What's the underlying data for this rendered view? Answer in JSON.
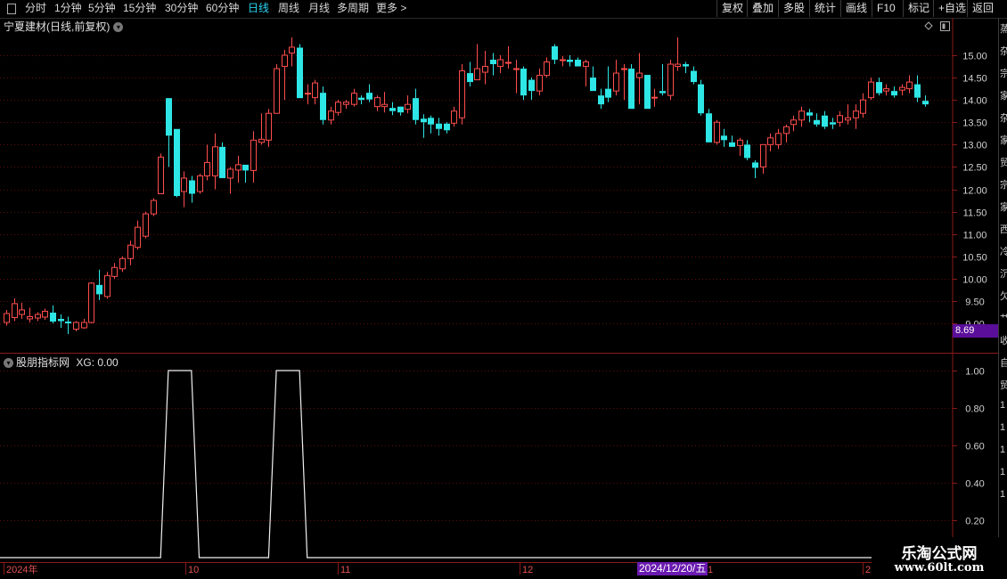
{
  "toolbar": {
    "timeframes": [
      "分时",
      "1分钟",
      "5分钟",
      "15分钟",
      "30分钟",
      "60分钟",
      "日线",
      "周线",
      "月线",
      "多周期",
      "更多 >"
    ],
    "active_timeframe": "日线",
    "buttons": [
      "复权",
      "叠加",
      "多股",
      "统计",
      "画线",
      "F10",
      "标记",
      "+自选",
      "返回"
    ]
  },
  "main_chart": {
    "title": "宁夏建材(日线,前复权)",
    "price_axis_labels": [
      "15.00",
      "14.50",
      "14.00",
      "13.50",
      "13.00",
      "12.50",
      "12.00",
      "11.50",
      "11.00",
      "10.50",
      "10.00",
      "9.50",
      "9.00"
    ],
    "current_price": "8.69",
    "colors": {
      "up": "#ff4d4d",
      "down": "#2ee6e6",
      "grid": "#5c0c0c",
      "axis_text": "#d0d0d0"
    }
  },
  "indicator": {
    "title": "股朋指标网",
    "value_text": "XG: 0.00",
    "axis_labels": [
      "1.00",
      "0.80",
      "0.60",
      "0.40",
      "0.20"
    ]
  },
  "time_axis": {
    "labels": [
      "2024年",
      "10",
      "11",
      "12",
      "1",
      "2"
    ],
    "selected_date": "2024/12/20/五"
  },
  "watermark": {
    "line1": "乐淘公式网",
    "line2": "www.60lt.com"
  },
  "side_panel": {
    "chars": [
      "蒸",
      "杂",
      "宗",
      "家",
      "杂",
      "家",
      "贸",
      "宗",
      "家",
      "西",
      "冷",
      "沉",
      "欠",
      "艹",
      "收",
      "自",
      "贸",
      "1",
      "1",
      "1",
      "1",
      "1"
    ]
  },
  "chart_data": {
    "type": "candlestick",
    "title": "宁夏建材(日线,前复权)",
    "ylim": [
      8.7,
      15.5
    ],
    "x_tick_labels": [
      "2024年",
      "10",
      "11",
      "12",
      "1",
      "2"
    ],
    "candles": [
      {
        "o": 9.02,
        "h": 9.3,
        "l": 8.95,
        "c": 9.22
      },
      {
        "o": 9.13,
        "h": 9.56,
        "l": 9.05,
        "c": 9.44
      },
      {
        "o": 9.2,
        "h": 9.46,
        "l": 9.1,
        "c": 9.3
      },
      {
        "o": 9.1,
        "h": 9.35,
        "l": 9.02,
        "c": 9.15
      },
      {
        "o": 9.12,
        "h": 9.25,
        "l": 9.05,
        "c": 9.2
      },
      {
        "o": 9.14,
        "h": 9.33,
        "l": 9.08,
        "c": 9.27
      },
      {
        "o": 9.24,
        "h": 9.4,
        "l": 9.0,
        "c": 9.04
      },
      {
        "o": 9.1,
        "h": 9.2,
        "l": 8.9,
        "c": 9.05
      },
      {
        "o": 9.04,
        "h": 9.15,
        "l": 8.76,
        "c": 9.0
      },
      {
        "o": 8.87,
        "h": 9.05,
        "l": 8.82,
        "c": 9.02
      },
      {
        "o": 8.9,
        "h": 9.1,
        "l": 8.88,
        "c": 9.02
      },
      {
        "o": 9.02,
        "h": 9.92,
        "l": 9.0,
        "c": 9.9
      },
      {
        "o": 9.86,
        "h": 10.2,
        "l": 9.52,
        "c": 9.65
      },
      {
        "o": 9.6,
        "h": 10.15,
        "l": 9.55,
        "c": 10.07
      },
      {
        "o": 10.05,
        "h": 10.35,
        "l": 10.0,
        "c": 10.25
      },
      {
        "o": 10.22,
        "h": 10.5,
        "l": 10.15,
        "c": 10.45
      },
      {
        "o": 10.45,
        "h": 10.85,
        "l": 10.3,
        "c": 10.75
      },
      {
        "o": 10.7,
        "h": 11.3,
        "l": 10.65,
        "c": 11.15
      },
      {
        "o": 10.95,
        "h": 11.5,
        "l": 10.9,
        "c": 11.45
      },
      {
        "o": 11.45,
        "h": 11.8,
        "l": 11.4,
        "c": 11.75
      },
      {
        "o": 11.9,
        "h": 12.8,
        "l": 11.9,
        "c": 12.72
      },
      {
        "o": 14.04,
        "h": 14.04,
        "l": 12.5,
        "c": 13.2
      },
      {
        "o": 13.35,
        "h": 13.35,
        "l": 11.82,
        "c": 11.85
      },
      {
        "o": 11.95,
        "h": 12.4,
        "l": 11.6,
        "c": 12.25
      },
      {
        "o": 12.2,
        "h": 12.3,
        "l": 11.7,
        "c": 11.9
      },
      {
        "o": 11.95,
        "h": 12.35,
        "l": 11.9,
        "c": 12.3
      },
      {
        "o": 12.3,
        "h": 13.0,
        "l": 12.2,
        "c": 12.6
      },
      {
        "o": 12.3,
        "h": 13.25,
        "l": 12.0,
        "c": 12.95
      },
      {
        "o": 12.95,
        "h": 13.05,
        "l": 12.25,
        "c": 12.25
      },
      {
        "o": 12.25,
        "h": 12.5,
        "l": 11.9,
        "c": 12.45
      },
      {
        "o": 12.43,
        "h": 12.75,
        "l": 12.15,
        "c": 12.55
      },
      {
        "o": 12.55,
        "h": 12.55,
        "l": 12.15,
        "c": 12.42
      },
      {
        "o": 12.42,
        "h": 13.3,
        "l": 12.15,
        "c": 13.1
      },
      {
        "o": 13.05,
        "h": 13.7,
        "l": 13.0,
        "c": 13.12
      },
      {
        "o": 13.1,
        "h": 13.8,
        "l": 12.95,
        "c": 13.7
      },
      {
        "o": 13.7,
        "h": 14.8,
        "l": 13.7,
        "c": 14.7
      },
      {
        "o": 14.75,
        "h": 15.12,
        "l": 14.0,
        "c": 15.0
      },
      {
        "o": 15.05,
        "h": 15.4,
        "l": 14.75,
        "c": 15.18
      },
      {
        "o": 15.17,
        "h": 15.25,
        "l": 14.04,
        "c": 14.04
      },
      {
        "o": 14.14,
        "h": 14.35,
        "l": 13.9,
        "c": 14.15
      },
      {
        "o": 14.05,
        "h": 14.45,
        "l": 13.9,
        "c": 14.38
      },
      {
        "o": 14.16,
        "h": 14.3,
        "l": 13.45,
        "c": 13.55
      },
      {
        "o": 13.55,
        "h": 13.85,
        "l": 13.45,
        "c": 13.75
      },
      {
        "o": 13.72,
        "h": 14.0,
        "l": 13.65,
        "c": 13.95
      },
      {
        "o": 13.9,
        "h": 14.0,
        "l": 13.8,
        "c": 13.95
      },
      {
        "o": 13.9,
        "h": 14.25,
        "l": 13.85,
        "c": 14.15
      },
      {
        "o": 14.05,
        "h": 14.1,
        "l": 13.9,
        "c": 14.0
      },
      {
        "o": 14.16,
        "h": 14.35,
        "l": 13.95,
        "c": 14.01
      },
      {
        "o": 13.85,
        "h": 14.1,
        "l": 13.75,
        "c": 14.05
      },
      {
        "o": 13.85,
        "h": 14.18,
        "l": 13.72,
        "c": 13.9
      },
      {
        "o": 13.82,
        "h": 13.95,
        "l": 13.66,
        "c": 13.75
      },
      {
        "o": 13.85,
        "h": 13.85,
        "l": 13.65,
        "c": 13.72
      },
      {
        "o": 13.79,
        "h": 14.1,
        "l": 13.7,
        "c": 13.9
      },
      {
        "o": 14.04,
        "h": 14.25,
        "l": 13.45,
        "c": 13.55
      },
      {
        "o": 13.58,
        "h": 13.68,
        "l": 13.15,
        "c": 13.5
      },
      {
        "o": 13.6,
        "h": 13.65,
        "l": 13.25,
        "c": 13.45
      },
      {
        "o": 13.47,
        "h": 13.6,
        "l": 13.2,
        "c": 13.35
      },
      {
        "o": 13.47,
        "h": 13.5,
        "l": 13.25,
        "c": 13.32
      },
      {
        "o": 13.48,
        "h": 13.85,
        "l": 13.4,
        "c": 13.75
      },
      {
        "o": 13.6,
        "h": 14.8,
        "l": 13.45,
        "c": 14.65
      },
      {
        "o": 14.6,
        "h": 14.85,
        "l": 14.3,
        "c": 14.4
      },
      {
        "o": 14.45,
        "h": 15.25,
        "l": 14.5,
        "c": 14.7
      },
      {
        "o": 14.62,
        "h": 15.1,
        "l": 14.35,
        "c": 14.75
      },
      {
        "o": 14.9,
        "h": 15.05,
        "l": 14.55,
        "c": 14.8
      },
      {
        "o": 14.75,
        "h": 15.0,
        "l": 14.6,
        "c": 14.9
      },
      {
        "o": 14.82,
        "h": 15.2,
        "l": 14.7,
        "c": 14.84
      },
      {
        "o": 14.7,
        "h": 14.9,
        "l": 14.15,
        "c": 14.7
      },
      {
        "o": 14.7,
        "h": 14.75,
        "l": 14.0,
        "c": 14.1
      },
      {
        "o": 14.45,
        "h": 14.5,
        "l": 14.0,
        "c": 14.2
      },
      {
        "o": 14.2,
        "h": 14.7,
        "l": 14.1,
        "c": 14.55
      },
      {
        "o": 14.55,
        "h": 14.95,
        "l": 14.5,
        "c": 14.85
      },
      {
        "o": 15.2,
        "h": 15.25,
        "l": 14.8,
        "c": 14.9
      },
      {
        "o": 14.88,
        "h": 14.98,
        "l": 14.75,
        "c": 14.9
      },
      {
        "o": 14.9,
        "h": 15.0,
        "l": 14.75,
        "c": 14.85
      },
      {
        "o": 14.9,
        "h": 14.95,
        "l": 14.75,
        "c": 14.75
      },
      {
        "o": 14.75,
        "h": 14.9,
        "l": 14.3,
        "c": 14.85
      },
      {
        "o": 14.5,
        "h": 14.75,
        "l": 14.2,
        "c": 14.2
      },
      {
        "o": 14.1,
        "h": 14.25,
        "l": 13.8,
        "c": 13.9
      },
      {
        "o": 14.25,
        "h": 14.75,
        "l": 13.95,
        "c": 14.05
      },
      {
        "o": 14.2,
        "h": 14.9,
        "l": 14.1,
        "c": 14.6
      },
      {
        "o": 14.7,
        "h": 14.8,
        "l": 14.0,
        "c": 14.7
      },
      {
        "o": 14.7,
        "h": 14.8,
        "l": 13.8,
        "c": 13.8
      },
      {
        "o": 14.5,
        "h": 15.05,
        "l": 13.9,
        "c": 14.6
      },
      {
        "o": 14.56,
        "h": 14.56,
        "l": 13.8,
        "c": 13.8
      },
      {
        "o": 14.06,
        "h": 14.25,
        "l": 13.85,
        "c": 14.06
      },
      {
        "o": 14.2,
        "h": 14.8,
        "l": 14.1,
        "c": 14.15
      },
      {
        "o": 14.1,
        "h": 14.9,
        "l": 14.0,
        "c": 14.8
      },
      {
        "o": 14.75,
        "h": 15.4,
        "l": 14.65,
        "c": 14.8
      },
      {
        "o": 14.8,
        "h": 14.85,
        "l": 14.6,
        "c": 14.75
      },
      {
        "o": 14.65,
        "h": 14.75,
        "l": 14.35,
        "c": 14.4
      },
      {
        "o": 14.35,
        "h": 14.45,
        "l": 13.65,
        "c": 13.7
      },
      {
        "o": 13.7,
        "h": 13.8,
        "l": 13.05,
        "c": 13.05
      },
      {
        "o": 13.05,
        "h": 13.55,
        "l": 13.0,
        "c": 13.5
      },
      {
        "o": 13.2,
        "h": 13.35,
        "l": 12.95,
        "c": 13.1
      },
      {
        "o": 13.05,
        "h": 13.2,
        "l": 12.95,
        "c": 12.95
      },
      {
        "o": 12.98,
        "h": 13.15,
        "l": 12.75,
        "c": 13.1
      },
      {
        "o": 13.0,
        "h": 13.1,
        "l": 12.65,
        "c": 12.7
      },
      {
        "o": 12.6,
        "h": 12.65,
        "l": 12.25,
        "c": 12.48
      },
      {
        "o": 12.5,
        "h": 13.0,
        "l": 12.35,
        "c": 13.0
      },
      {
        "o": 13.0,
        "h": 13.25,
        "l": 12.85,
        "c": 13.15
      },
      {
        "o": 13.0,
        "h": 13.35,
        "l": 12.9,
        "c": 13.25
      },
      {
        "o": 13.25,
        "h": 13.45,
        "l": 13.05,
        "c": 13.4
      },
      {
        "o": 13.45,
        "h": 13.65,
        "l": 13.3,
        "c": 13.55
      },
      {
        "o": 13.55,
        "h": 13.85,
        "l": 13.4,
        "c": 13.75
      },
      {
        "o": 13.72,
        "h": 13.8,
        "l": 13.5,
        "c": 13.65
      },
      {
        "o": 13.55,
        "h": 13.7,
        "l": 13.4,
        "c": 13.45
      },
      {
        "o": 13.65,
        "h": 13.75,
        "l": 13.35,
        "c": 13.4
      },
      {
        "o": 13.5,
        "h": 13.6,
        "l": 13.35,
        "c": 13.45
      },
      {
        "o": 13.5,
        "h": 13.75,
        "l": 13.4,
        "c": 13.65
      },
      {
        "o": 13.55,
        "h": 13.9,
        "l": 13.45,
        "c": 13.6
      },
      {
        "o": 13.6,
        "h": 13.9,
        "l": 13.35,
        "c": 13.75
      },
      {
        "o": 13.7,
        "h": 14.15,
        "l": 13.6,
        "c": 14.0
      },
      {
        "o": 14.05,
        "h": 14.5,
        "l": 14.0,
        "c": 14.4
      },
      {
        "o": 14.4,
        "h": 14.5,
        "l": 14.1,
        "c": 14.15
      },
      {
        "o": 14.2,
        "h": 14.35,
        "l": 14.1,
        "c": 14.25
      },
      {
        "o": 14.2,
        "h": 14.3,
        "l": 14.05,
        "c": 14.1
      },
      {
        "o": 14.22,
        "h": 14.35,
        "l": 14.1,
        "c": 14.28
      },
      {
        "o": 14.25,
        "h": 14.55,
        "l": 14.15,
        "c": 14.4
      },
      {
        "o": 14.35,
        "h": 14.55,
        "l": 13.95,
        "c": 14.05
      },
      {
        "o": 13.98,
        "h": 14.1,
        "l": 13.85,
        "c": 13.9
      }
    ],
    "indicator_series": {
      "name": "XG",
      "values_by_candle_index": "0 except 1.00 at indices 21-24 and 35-38",
      "ones": [
        21,
        22,
        23,
        24,
        35,
        36,
        37,
        38
      ],
      "ylim": [
        0,
        1.05
      ]
    }
  }
}
